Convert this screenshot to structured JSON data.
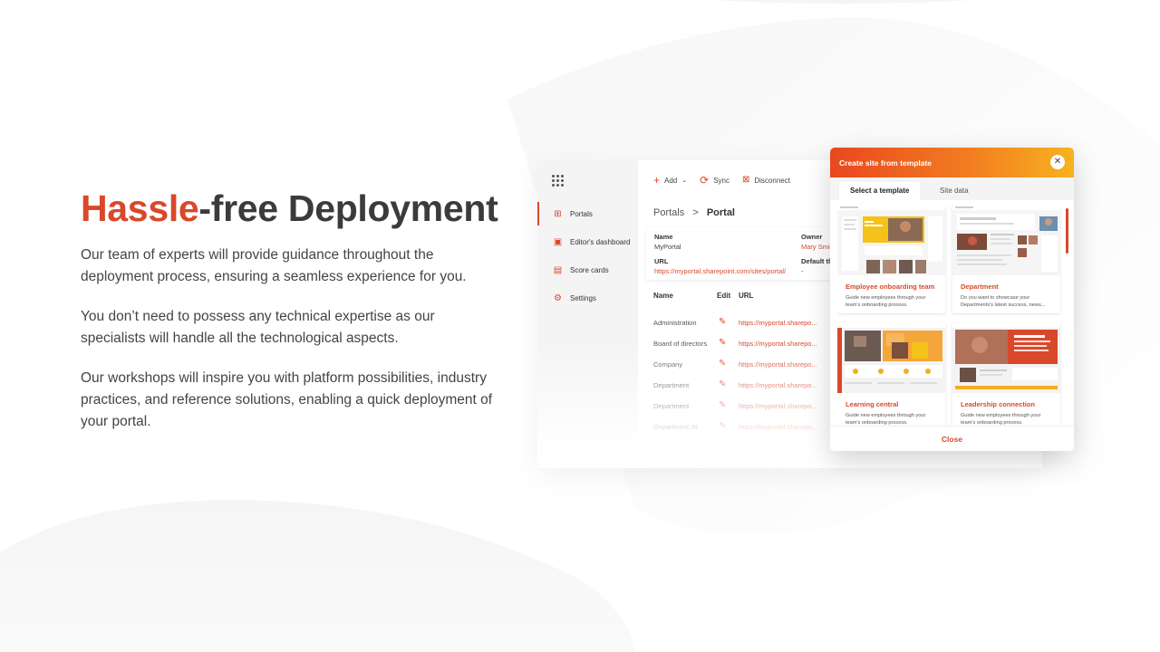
{
  "hero": {
    "title_accent": "Hassle",
    "title_rest": "-free Deployment",
    "paragraphs": [
      "Our team of experts will provide guidance throughout the deployment process, ensuring a seamless experience for you.",
      "You don’t need to possess any technical expertise as our specialists will handle all the technological aspects.",
      "Our workshops will inspire you with platform possibilities, industry practices, and reference solutions, enabling a quick deployment of your portal."
    ]
  },
  "app": {
    "sidebar": [
      {
        "label": "Portals",
        "icon": "sitemap-icon"
      },
      {
        "label": "Editor's dashboard",
        "icon": "dashboard-icon"
      },
      {
        "label": "Score cards",
        "icon": "scorecard-icon"
      },
      {
        "label": "Settings",
        "icon": "gear-icon"
      }
    ],
    "toolbar": {
      "add": "Add",
      "sync": "Sync",
      "disconnect": "Disconnect"
    },
    "breadcrumb": {
      "parent": "Portals",
      "separator": ">",
      "current": "Portal"
    },
    "info": {
      "name_label": "Name",
      "name_value": "MyPortal",
      "owner_label": "Owner",
      "owner_value": "Mary Smi",
      "url_label": "URL",
      "url_value": "https://myportal.sharepoint.com/sites/portal/",
      "default_label": "Default th",
      "default_value": "-"
    },
    "table": {
      "headers": {
        "name": "Name",
        "edit": "Edit",
        "url": "URL"
      },
      "rows": [
        {
          "name": "Administration",
          "url": "https://myportal.sharepo..."
        },
        {
          "name": "Board of directors",
          "url": "https://myportal.sharepo..."
        },
        {
          "name": "Company",
          "url": "https://myportal.sharepo..."
        },
        {
          "name": "Department",
          "url": "https://myportal.sharepo..."
        },
        {
          "name": "Department",
          "url": "https://myportal.sharepo..."
        },
        {
          "name": "Department IN",
          "url": "https://myportal.sharepo..."
        }
      ]
    }
  },
  "modal": {
    "title": "Create site from template",
    "tabs": [
      "Select a template",
      "Site data"
    ],
    "cards": [
      {
        "title": "Employee onboarding team",
        "desc": "Guide new employees through your team's onboarding process."
      },
      {
        "title": "Department",
        "desc": "Do you want to showcase your Departments's latest success, news..."
      },
      {
        "title": "Learning central",
        "desc": "Guide new employees through your team's onboarding process."
      },
      {
        "title": "Leadership connection",
        "desc": "Guide new employees through your team's onboarding process."
      }
    ],
    "close_label": "Close"
  },
  "colors": {
    "accent": "#d9482b",
    "gradient_start": "#e9471f",
    "gradient_end": "#f7b21f"
  }
}
